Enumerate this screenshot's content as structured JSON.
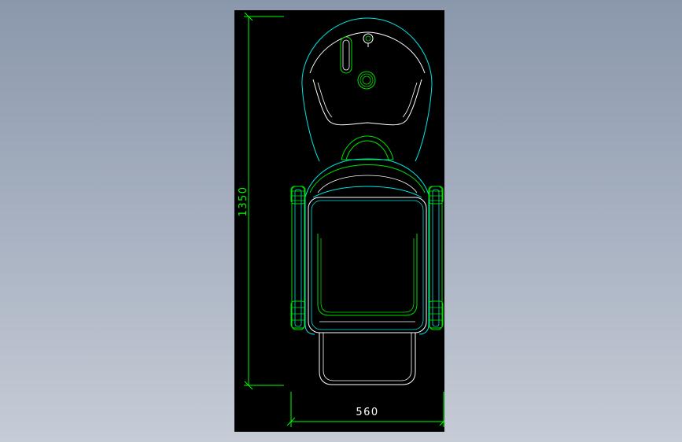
{
  "drawing": {
    "dimensions": {
      "height_label": "1350",
      "width_label": "560"
    },
    "colors": {
      "background": "#000000",
      "primary_outline": "#00e5e5",
      "secondary_outline": "#00e000",
      "detail_outline": "#ffffff",
      "dimension_color": "#00ff00"
    }
  }
}
